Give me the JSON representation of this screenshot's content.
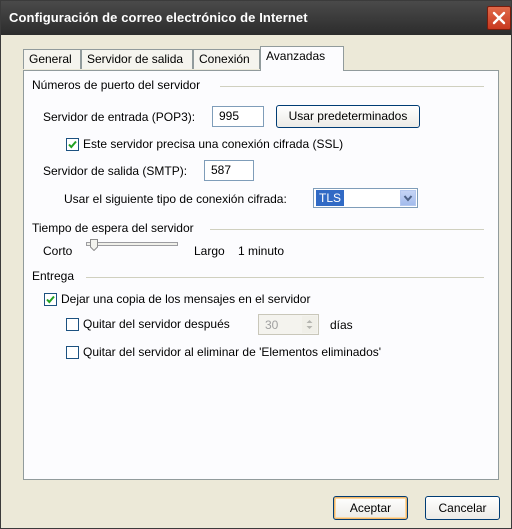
{
  "window": {
    "title": "Configuración de correo electrónico de Internet"
  },
  "tabs": [
    "General",
    "Servidor de salida",
    "Conexión",
    "Avanzadas"
  ],
  "active_tab": "Avanzadas",
  "ports": {
    "group_label": "Números de puerto del servidor",
    "incoming_label": "Servidor de entrada (POP3):",
    "incoming_value": "995",
    "defaults_button": "Usar predeterminados",
    "ssl_label": "Este servidor precisa una conexión cifrada (SSL)",
    "ssl_checked": true,
    "outgoing_label": "Servidor de salida (SMTP):",
    "outgoing_value": "587",
    "encryption_label": "Usar el siguiente tipo de conexión cifrada:",
    "encryption_value": "TLS"
  },
  "timeout": {
    "group_label": "Tiempo de espera del servidor",
    "short_label": "Corto",
    "long_label": "Largo",
    "value_text": "1 minuto",
    "slider_fraction": 0.05
  },
  "delivery": {
    "group_label": "Entrega",
    "keep_copy_label": "Dejar una copia de los mensajes en el servidor",
    "keep_copy_checked": true,
    "remove_after_label": "Quitar del servidor después",
    "remove_after_checked": false,
    "remove_after_days": "30",
    "days_label": "días",
    "remove_deleted_label": "Quitar del servidor al eliminar de 'Elementos eliminados'",
    "remove_deleted_checked": false
  },
  "buttons": {
    "ok": "Aceptar",
    "cancel": "Cancelar"
  }
}
